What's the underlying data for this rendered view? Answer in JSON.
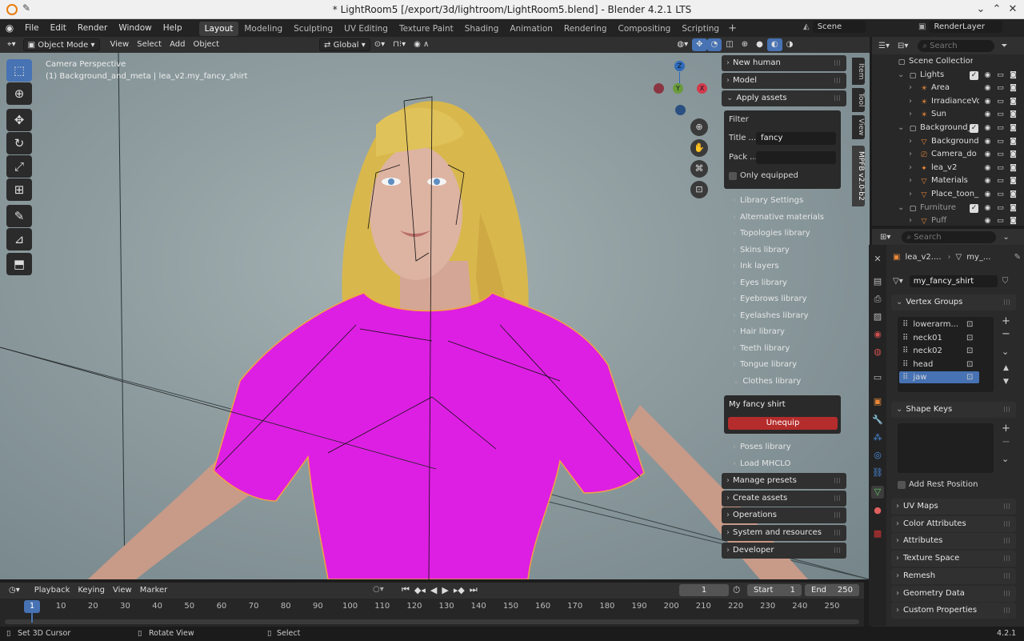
{
  "window": {
    "title": "* LightRoom5 [/export/3d/lightroom/LightRoom5.blend] - Blender 4.2.1 LTS"
  },
  "menu": [
    "File",
    "Edit",
    "Render",
    "Window",
    "Help"
  ],
  "workspaces": [
    "Layout",
    "Modeling",
    "Sculpting",
    "UV Editing",
    "Texture Paint",
    "Shading",
    "Animation",
    "Rendering",
    "Compositing",
    "Scripting"
  ],
  "scene_name": "Scene",
  "render_layer": "RenderLayer",
  "viewport_header": {
    "mode": "Object Mode",
    "menus": [
      "View",
      "Select",
      "Add",
      "Object"
    ],
    "orientation": "Global"
  },
  "viewport_overlay": {
    "line1": "Camera Perspective",
    "line2": "(1) Background_and_meta | lea_v2.my_fancy_shirt"
  },
  "gizmo": {
    "z": "Z",
    "y": "Y",
    "x": "X"
  },
  "npanel": {
    "tabs": [
      "Item",
      "Tool",
      "View",
      "MPFB v2.0-b2"
    ],
    "sections_top": [
      "New human",
      "Model"
    ],
    "apply_assets": {
      "label": "Apply assets",
      "filter_label": "Filter",
      "title_label": "Title ...",
      "title_value": "fancy",
      "pack_label": "Pack ...",
      "pack_value": "",
      "only_equipped": "Only equipped",
      "libraries": [
        "Library Settings",
        "Alternative materials",
        "Topologies library",
        "Skins library",
        "Ink layers",
        "Eyes library",
        "Eyebrows library",
        "Eyelashes library",
        "Hair library",
        "Teeth library",
        "Tongue library"
      ],
      "clothes_library": "Clothes library",
      "clothes_item": "My fancy shirt",
      "unequip": "Unequip",
      "libraries_after": [
        "Poses library",
        "Load MHCLO"
      ]
    },
    "sections_bottom": [
      "Manage presets",
      "Create assets",
      "Operations",
      "System and resources",
      "Developer"
    ]
  },
  "outliner": {
    "search_placeholder": "Search",
    "rows": [
      {
        "label": "Scene Collection",
        "indent": 0,
        "icon": "collection-icon",
        "vis": false
      },
      {
        "label": "Lights",
        "indent": 1,
        "icon": "collection-icon",
        "vis": true
      },
      {
        "label": "Area",
        "indent": 2,
        "icon": "light-icon",
        "vis": true
      },
      {
        "label": "IrradianceVo",
        "indent": 2,
        "icon": "light-icon",
        "vis": true
      },
      {
        "label": "Sun",
        "indent": 2,
        "icon": "light-icon",
        "vis": true
      },
      {
        "label": "Background_and",
        "indent": 1,
        "icon": "collection-icon",
        "vis": true
      },
      {
        "label": "Background",
        "indent": 2,
        "icon": "mesh-icon",
        "vis": true
      },
      {
        "label": "Camera_do",
        "indent": 2,
        "icon": "camera-icon",
        "vis": true
      },
      {
        "label": "lea_v2",
        "indent": 2,
        "icon": "armature-icon",
        "vis": true
      },
      {
        "label": "Materials",
        "indent": 2,
        "icon": "mesh-icon",
        "vis": true
      },
      {
        "label": "Place_toon_l",
        "indent": 2,
        "icon": "mesh-icon",
        "vis": true
      },
      {
        "label": "Furniture",
        "indent": 1,
        "icon": "collection-icon",
        "vis": true
      },
      {
        "label": "Puff",
        "indent": 2,
        "icon": "mesh-icon",
        "vis": true
      }
    ]
  },
  "properties": {
    "search_placeholder": "Search",
    "breadcrumb_obj": "lea_v2....",
    "breadcrumb_data": "my_...",
    "mesh_name": "my_fancy_shirt",
    "vertex_groups_label": "Vertex Groups",
    "vertex_groups": [
      "lowerarm...",
      "neck01",
      "neck02",
      "head",
      "jaw"
    ],
    "shape_keys_label": "Shape Keys",
    "add_rest_position": "Add Rest Position",
    "sections": [
      "UV Maps",
      "Color Attributes",
      "Attributes",
      "Texture Space",
      "Remesh",
      "Geometry Data",
      "Custom Properties"
    ]
  },
  "timeline": {
    "menus": [
      "Playback",
      "Keying",
      "View",
      "Marker"
    ],
    "current_frame": "1",
    "start_label": "Start",
    "start": "1",
    "end_label": "End",
    "end": "250",
    "ticks": [
      "1",
      "10",
      "20",
      "30",
      "40",
      "50",
      "60",
      "70",
      "80",
      "90",
      "100",
      "110",
      "120",
      "130",
      "140",
      "150",
      "160",
      "170",
      "180",
      "190",
      "200",
      "210",
      "220",
      "230",
      "240",
      "250"
    ]
  },
  "status": {
    "left": "Set 3D Cursor",
    "mid": "Rotate View",
    "right": "Select",
    "version": "4.2.1"
  }
}
